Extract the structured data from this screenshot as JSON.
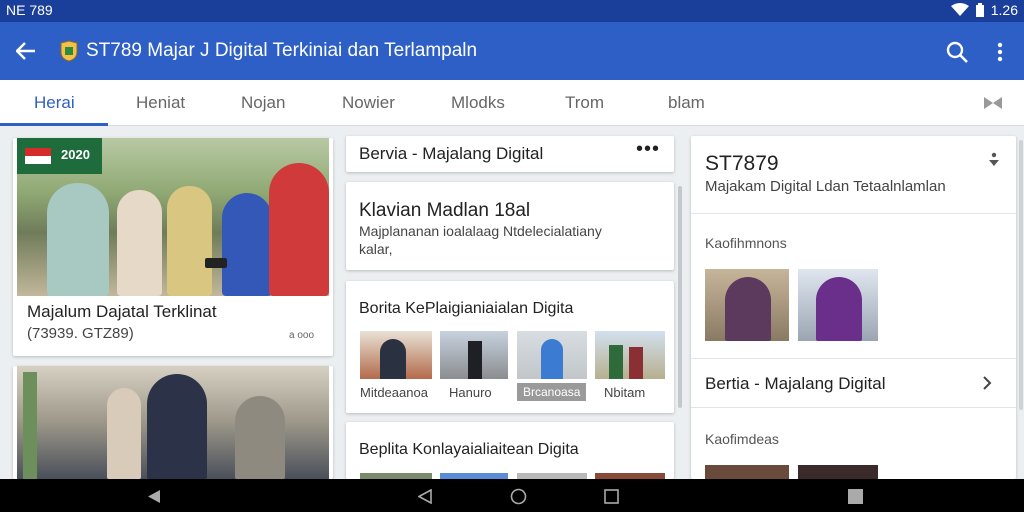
{
  "status_bar": {
    "left_text": "NE 789",
    "time": "1.26",
    "icons": [
      "wifi-icon",
      "battery-icon"
    ]
  },
  "app_bar": {
    "title": "ST789 Majar J Digital Terkiniai dan Terlampaln",
    "icons": [
      "back-arrow-icon",
      "shield-logo-icon",
      "search-icon",
      "more-vert-icon"
    ]
  },
  "tabs": [
    {
      "label": "Herai",
      "active": true
    },
    {
      "label": "Heniat",
      "active": false
    },
    {
      "label": "Nojan",
      "active": false
    },
    {
      "label": "Nowier",
      "active": false
    },
    {
      "label": "Mlodks",
      "active": false
    },
    {
      "label": "Trom",
      "active": false
    },
    {
      "label": "blam",
      "active": false
    }
  ],
  "left_column": {
    "hero_card": {
      "badge": "2020",
      "title": "Majalum Dajatal Terklinat",
      "subtitle": "(73939. GTZ89)",
      "meta": "a ooo"
    }
  },
  "middle_column": {
    "header_card": {
      "title": "Bervia - Majalang Digital"
    },
    "article_card": {
      "title": "Klavian Madlan 18al",
      "snippet_line1": "Majplananan ioalalaag Ntdelecialatiany",
      "snippet_line2": "kalar,"
    },
    "gallery_card": {
      "title": "Borita KePlaigianiaialan Digita",
      "items": [
        {
          "caption": "Mitdeaanoa",
          "highlight": false
        },
        {
          "caption": "Hanuro",
          "highlight": false
        },
        {
          "caption": "Brcanoasa",
          "highlight": true
        },
        {
          "caption": "Nbitam",
          "highlight": false
        }
      ]
    },
    "partial_card": {
      "title": "Beplita Konlayaialiaitean Digita"
    }
  },
  "right_column": {
    "profile": {
      "title": "ST7879",
      "subtitle": "Majakam Digital Ldan Tetaalnlamlan"
    },
    "section1_label": "Kaofihmnons",
    "link_row": "Bertia - Majalang Digital",
    "section2_label": "Kaofimdeas"
  },
  "nav_bar": {
    "icons": [
      "back-triangle-icon",
      "back-outline-icon",
      "home-circle-icon",
      "recents-square-icon",
      "recents-filled-icon"
    ]
  }
}
